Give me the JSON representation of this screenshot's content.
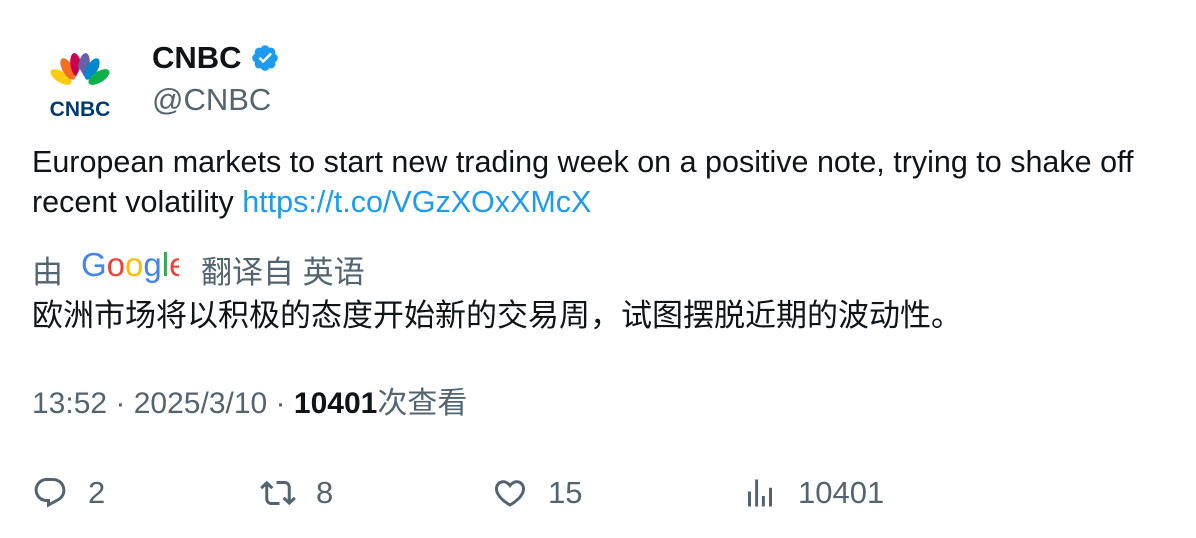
{
  "author": {
    "name": "CNBC",
    "handle": "@CNBC",
    "logo_text": "CNBC",
    "verified": true
  },
  "tweet": {
    "text": "European markets to start new trading week on a positive note, trying to shake off recent volatility ",
    "link": "https://t.co/VGzXOxXMcX"
  },
  "translation": {
    "prefix": "由",
    "provider": "Google",
    "suffix": "翻译自 英语",
    "text": "欧洲市场将以积极的态度开始新的交易周，试图摆脱近期的波动性。"
  },
  "meta": {
    "time": "13:52",
    "separator": " · ",
    "date": "2025/3/10",
    "views_count": "10401",
    "views_label": "次查看"
  },
  "actions": {
    "replies": "2",
    "retweets": "8",
    "likes": "15",
    "views": "10401"
  },
  "colors": {
    "text_primary": "#0f1419",
    "text_secondary": "#536471",
    "link": "#1d9bf0",
    "verified": "#1d9bf0"
  }
}
